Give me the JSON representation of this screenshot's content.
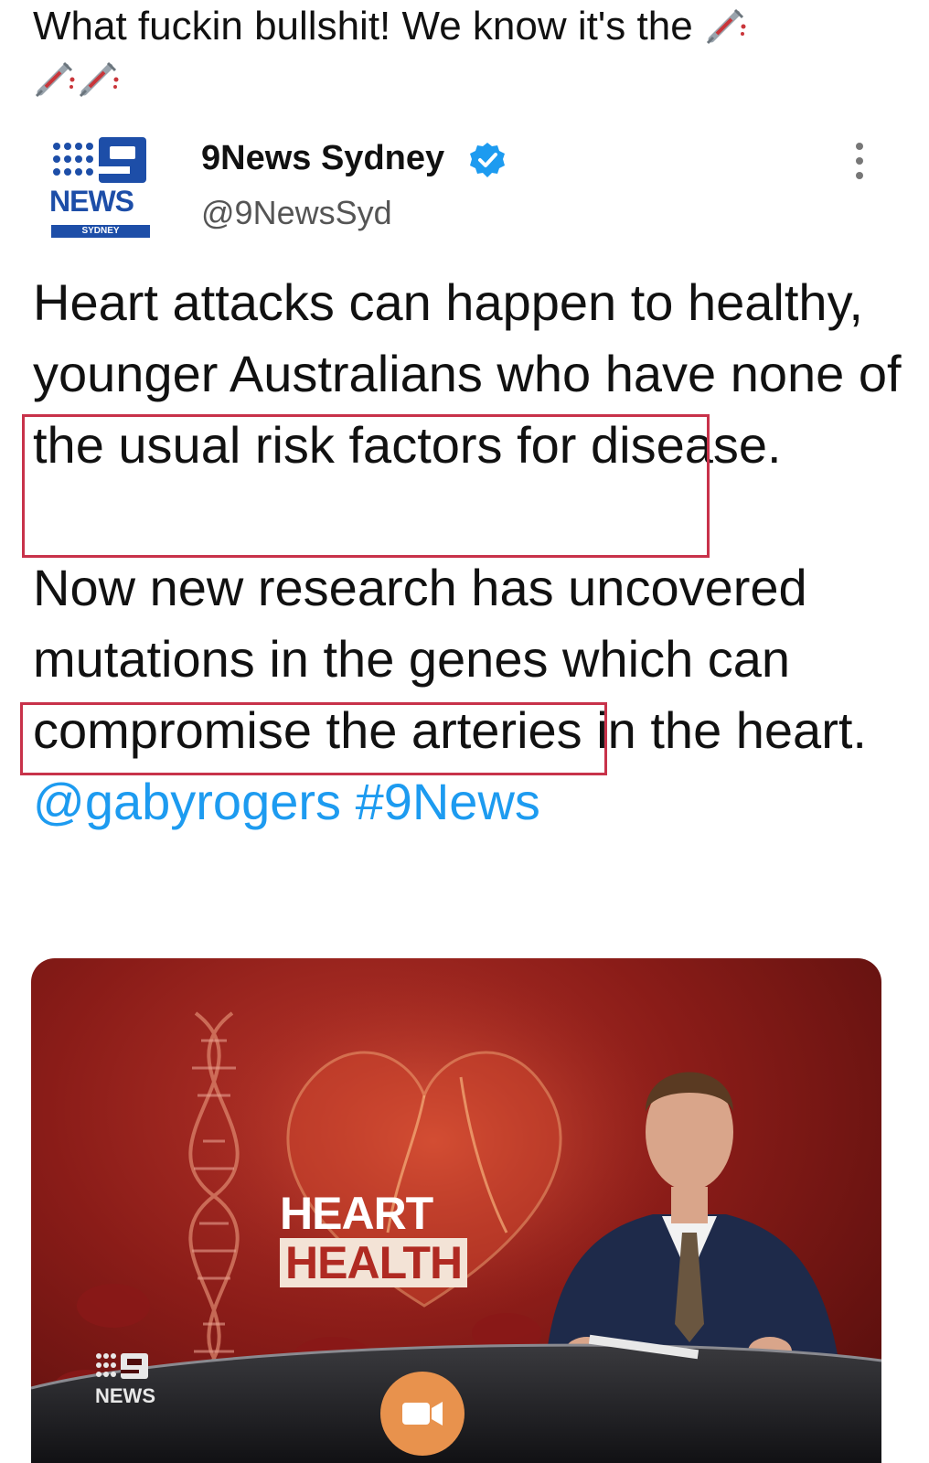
{
  "caption": {
    "text": "What fuckin bullshit! We know it's the",
    "icons": [
      "syringe-icon",
      "syringe-icon",
      "syringe-icon"
    ]
  },
  "tweet": {
    "author_name": "9News Sydney",
    "handle": "@9NewsSyd",
    "logo_text": "NEWS",
    "logo_subtext": "SYDNEY",
    "verified": true,
    "paragraph1": {
      "before": "Heart attacks can happen to healthy, younger Australians who ",
      "highlight": "have none of the usual risk factors for disease."
    },
    "paragraph2": {
      "before": "Now new research has uncovered ",
      "highlight": "mutations in the genes",
      "after": " which can compromise the arteries in the heart. ",
      "mention": "@gabyrogers",
      "hashtag": "#9News"
    },
    "media": {
      "overlay_line1": "HEART",
      "overlay_line2": "HEALTH",
      "watermark": "NEWS"
    }
  },
  "colors": {
    "link": "#1d9bf0",
    "highlight_border": "#c8324a",
    "brand_blue": "#1d4ea8",
    "video_button": "#e8924d"
  }
}
